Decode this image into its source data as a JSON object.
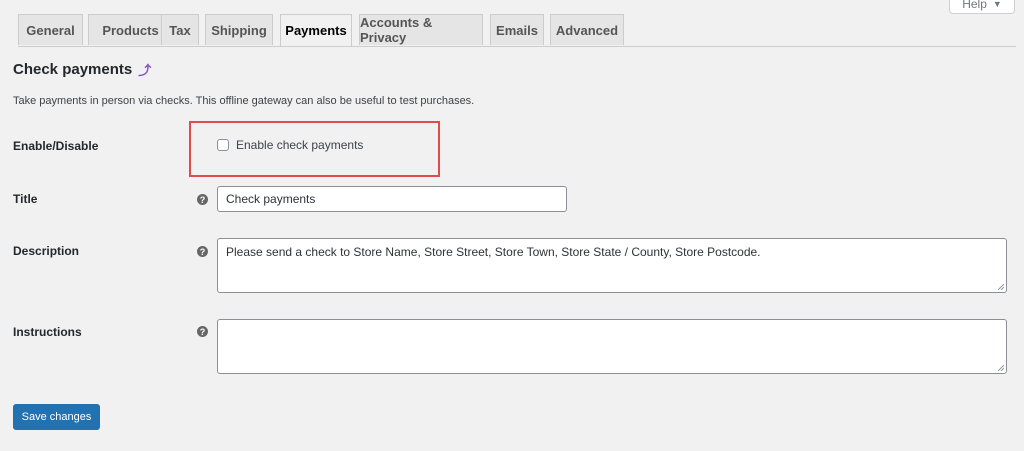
{
  "help": {
    "label": "Help",
    "caret": "▼"
  },
  "tabs": [
    {
      "label": "General",
      "active": false
    },
    {
      "label": "Products",
      "active": false
    },
    {
      "label": "Tax",
      "active": false
    },
    {
      "label": "Shipping",
      "active": false
    },
    {
      "label": "Payments",
      "active": true
    },
    {
      "label": "Accounts & Privacy",
      "active": false
    },
    {
      "label": "Emails",
      "active": false
    },
    {
      "label": "Advanced",
      "active": false
    }
  ],
  "section": {
    "title": "Check payments",
    "description": "Take payments in person via checks. This offline gateway can also be useful to test purchases."
  },
  "fields": {
    "enable": {
      "label": "Enable/Disable",
      "checkbox_label": "Enable check payments",
      "checked": false
    },
    "title": {
      "label": "Title",
      "value": "Check payments"
    },
    "description": {
      "label": "Description",
      "value": "Please send a check to Store Name, Store Street, Store Town, Store State / County, Store Postcode."
    },
    "instructions": {
      "label": "Instructions",
      "value": ""
    }
  },
  "save_button": "Save changes",
  "colors": {
    "primary_button": "#2271b1",
    "highlight_box": "#e04b4b",
    "link_icon": "#8a4fc5"
  }
}
